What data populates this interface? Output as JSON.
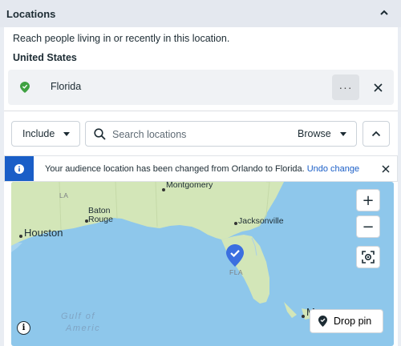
{
  "header": {
    "title": "Locations"
  },
  "panel": {
    "intro": "Reach people living in or recently in this location.",
    "country": "United States",
    "location": {
      "name": "Florida",
      "more_label": "···"
    }
  },
  "controls": {
    "include_label": "Include",
    "search_placeholder": "Search locations",
    "browse_label": "Browse"
  },
  "notice": {
    "message": "Your audience location has been changed from Orlando to Florida.",
    "undo_label": "Undo change"
  },
  "map": {
    "labels": {
      "montgomery": "Montgomery",
      "la": "LA",
      "baton_rouge_1": "Baton",
      "baton_rouge_2": "Rouge",
      "houston": "Houston",
      "jacksonville": "Jacksonville",
      "fla": "FLA",
      "gulf_1": "Gulf of",
      "gulf_2": "Americ",
      "partial_city": "M"
    },
    "zoom_in": "+",
    "zoom_out": "−",
    "info": "i",
    "drop_pin_label": "Drop pin"
  },
  "colors": {
    "land": "#d3e6b8",
    "water": "#8ec7eb",
    "accent": "#1a5ec7",
    "pin_green": "#3fa142",
    "marker": "#3b6fe0"
  }
}
